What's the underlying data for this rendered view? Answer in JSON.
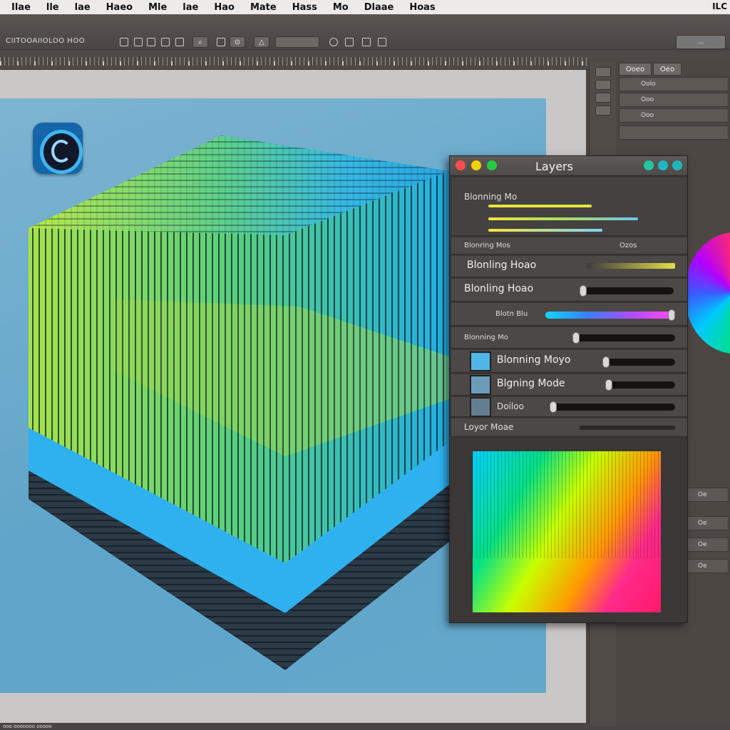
{
  "menubar": {
    "items": [
      "Ilae",
      "lle",
      "lae",
      "Haeo",
      "Mle",
      "lae",
      "Hao",
      "Mate",
      "Hass",
      "Mo",
      "Dlaae",
      "Hoas"
    ],
    "right_text": "ILC"
  },
  "toolbar": {
    "label": "CIITOOAIIOLOO HOO",
    "buttons": [
      "⌕",
      "⊙",
      "△"
    ],
    "right_button": "..."
  },
  "layers_panel": {
    "title": "Layers",
    "title_dots": [
      "#ff4d4d",
      "#f7d000",
      "#26c940",
      "#22c7a0",
      "#1fb7c8",
      "#20b6b9"
    ],
    "blending_label": "Blonning Mo",
    "row_small_left": "Blonring Mos",
    "row_small_right": "Ozos",
    "rows": [
      {
        "label": "Blonling Hoao"
      },
      {
        "label": "Blonling Hoao"
      },
      {
        "label": "Blotn Blu"
      },
      {
        "label": "Blonning Mo"
      },
      {
        "label": "Blonning Moyo"
      },
      {
        "label": "Blgning Mode"
      },
      {
        "label": "Doiloo"
      },
      {
        "label": "Loyor Moae"
      }
    ],
    "sliders": {
      "row2": 0.03,
      "row3": 0.95,
      "row4": 0.02,
      "row5": 0.05,
      "row6": 0.03,
      "row7": 0.01
    }
  },
  "right_panel": {
    "tab1": "Ooeo",
    "tab2": "Oeo",
    "rows": [
      "Oolo",
      "Ooo",
      "Ooo"
    ],
    "small_rows": [
      "Oe",
      "Oe",
      "Oe",
      "Oe"
    ]
  },
  "bottom": {
    "text": "ooo ooooooo ooooo"
  }
}
